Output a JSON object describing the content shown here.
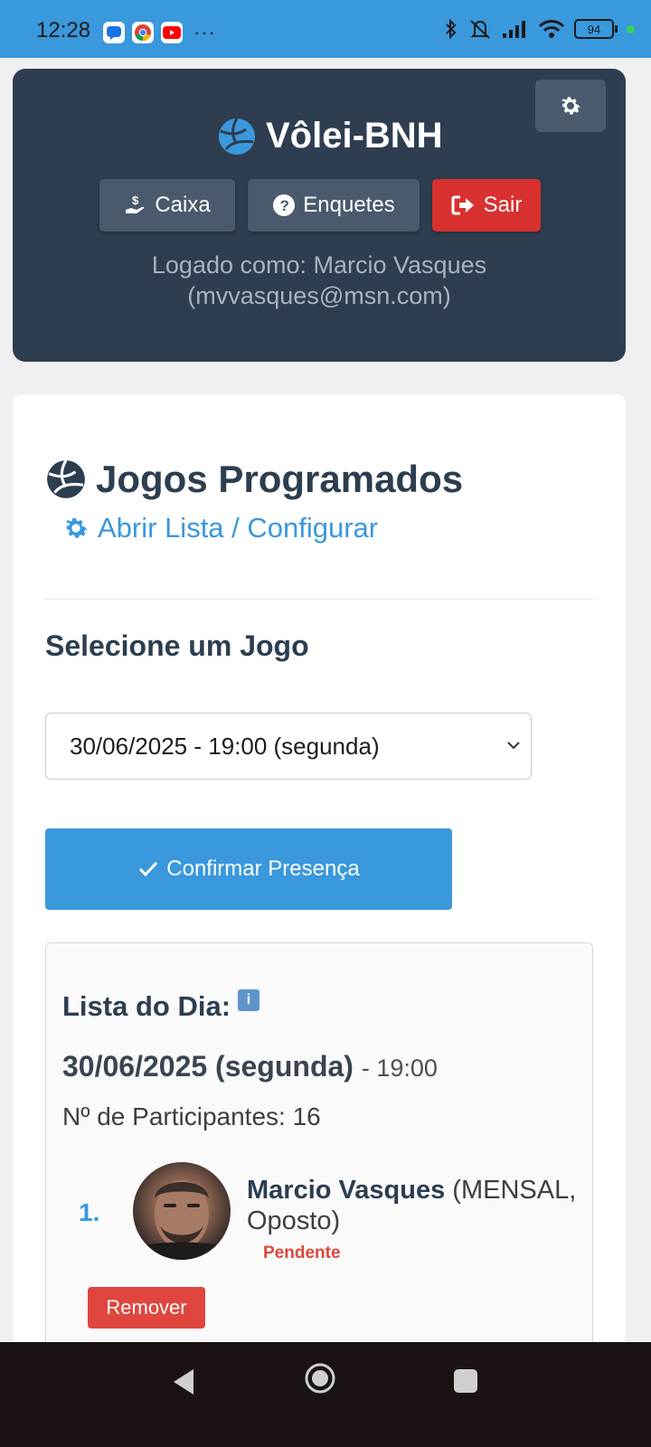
{
  "status_bar": {
    "time": "12:28",
    "battery": "94",
    "more_indicator": "···",
    "icons": [
      "messages-icon",
      "chrome-icon",
      "youtube-icon",
      "bluetooth-icon",
      "silent-icon",
      "signal-icon",
      "wifi-icon",
      "battery-icon"
    ]
  },
  "header": {
    "brand_title": "Vôlei-BNH",
    "nav": {
      "caixa": "Caixa",
      "enquetes": "Enquetes",
      "sair": "Sair"
    },
    "logged_line1": "Logado como: Marcio Vasques",
    "logged_line2": "(mvvasques@msn.com)"
  },
  "main": {
    "title": "Jogos Programados",
    "open_link": "Abrir Lista / Configurar",
    "select_label": "Selecione um Jogo",
    "selected_game": "30/06/2025 - 19:00 (segunda)",
    "confirm_button": "Confirmar Presença",
    "lista": {
      "title": "Lista do Dia:",
      "date": "30/06/2025 (segunda)",
      "time": "- 19:00",
      "participants_line": "Nº de Participantes: 16",
      "participants": [
        {
          "number": "1.",
          "name": "Marcio Vasques",
          "detail": "(MENSAL, Oposto)",
          "status": "Pendente"
        }
      ],
      "remove_button": "Remover"
    }
  },
  "colors": {
    "accent": "#3a98dc",
    "header_bg": "#2e3e50",
    "danger": "#d9312f",
    "status_pending": "#d9493a"
  }
}
